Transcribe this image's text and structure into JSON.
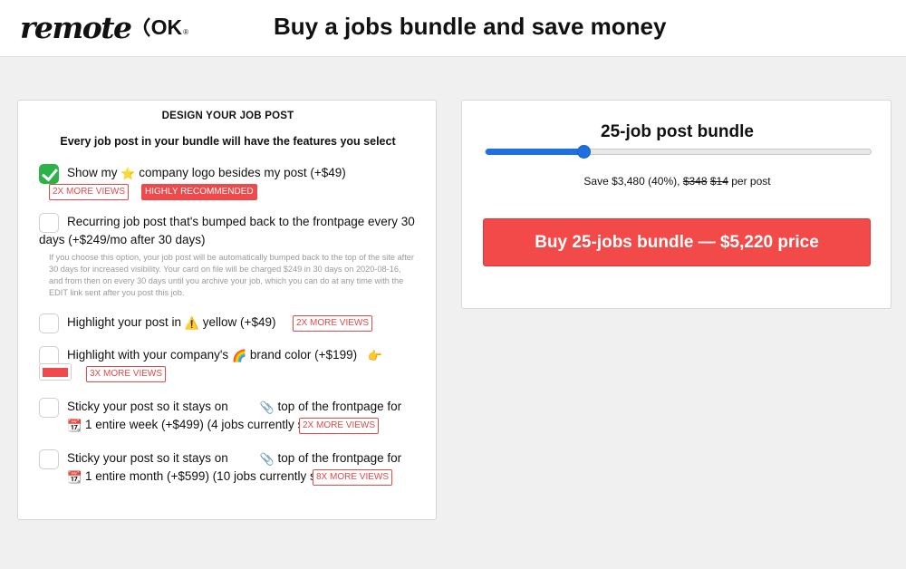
{
  "brand": {
    "logo_word": "remote",
    "logo_ok": "OK",
    "logo_reg": "®"
  },
  "header": {
    "headline": "Buy a jobs bundle and save money"
  },
  "design": {
    "title": "DESIGN YOUR JOB POST",
    "subtitle": "Every job post in your bundle will have the features you select",
    "options": [
      {
        "checked": true,
        "text_a": "Show my",
        "icon": "star-icon",
        "text_b": "company logo besides my post (+$49)",
        "badges": [
          "2X MORE VIEWS",
          "HIGHLY RECOMMENDED"
        ]
      },
      {
        "checked": false,
        "text": "Recurring job post that's bumped back to the frontpage every 30 days (+$249/mo after 30 days)",
        "fine_print": "If you choose this option, your job post will be automatically bumped back to the top of the site after 30 days for increased visibility. Your card on file will be charged $249 in 30 days on 2020-08-16, and from then on every 30 days until you archive your job, which you can do at any time with the EDIT link sent after you post this job."
      },
      {
        "checked": false,
        "text_a": "Highlight your post in",
        "icon": "warning-icon",
        "text_b": "yellow (+$49)",
        "badges": [
          "2X MORE VIEWS"
        ]
      },
      {
        "checked": false,
        "text_a": "Highlight with your company's",
        "icon": "rainbow-icon",
        "text_b": "brand color (+$199)",
        "pointer_icon": "pointing-hand-icon",
        "swatch_color": "#f0494b",
        "badges": [
          "3X MORE VIEWS"
        ]
      },
      {
        "checked": false,
        "text_a": "Sticky your post so it stays on",
        "icon": "paperclip-icon",
        "text_b": "top of the frontpage for",
        "cal_icon": "calendar-icon",
        "text_c": "1",
        "text_d": "entire week (+$499) (4 jobs currently stickied)",
        "badges": [
          "2X MORE VIEWS"
        ]
      },
      {
        "checked": false,
        "text_a": "Sticky your post so it stays on",
        "icon": "paperclip-icon",
        "text_b": "top of the frontpage for",
        "cal_icon": "calendar-icon",
        "text_c": "1",
        "text_d": "entire month (+$599) (10 jobs currently stickied)",
        "badges": [
          "8X MORE VIEWS"
        ]
      }
    ]
  },
  "bundle": {
    "title": "25-job post bundle",
    "slider_fraction": 0.255,
    "save_prefix": "Save $3,480 (40%),",
    "old_price": "$348",
    "new_price": "$14",
    "save_suffix": "per post",
    "buy_label": "Buy 25-jobs bundle — $5,220 price"
  },
  "colors": {
    "accent_red": "#f24a48",
    "check_green": "#2bb34a",
    "slider_blue": "#1e6fe0"
  }
}
